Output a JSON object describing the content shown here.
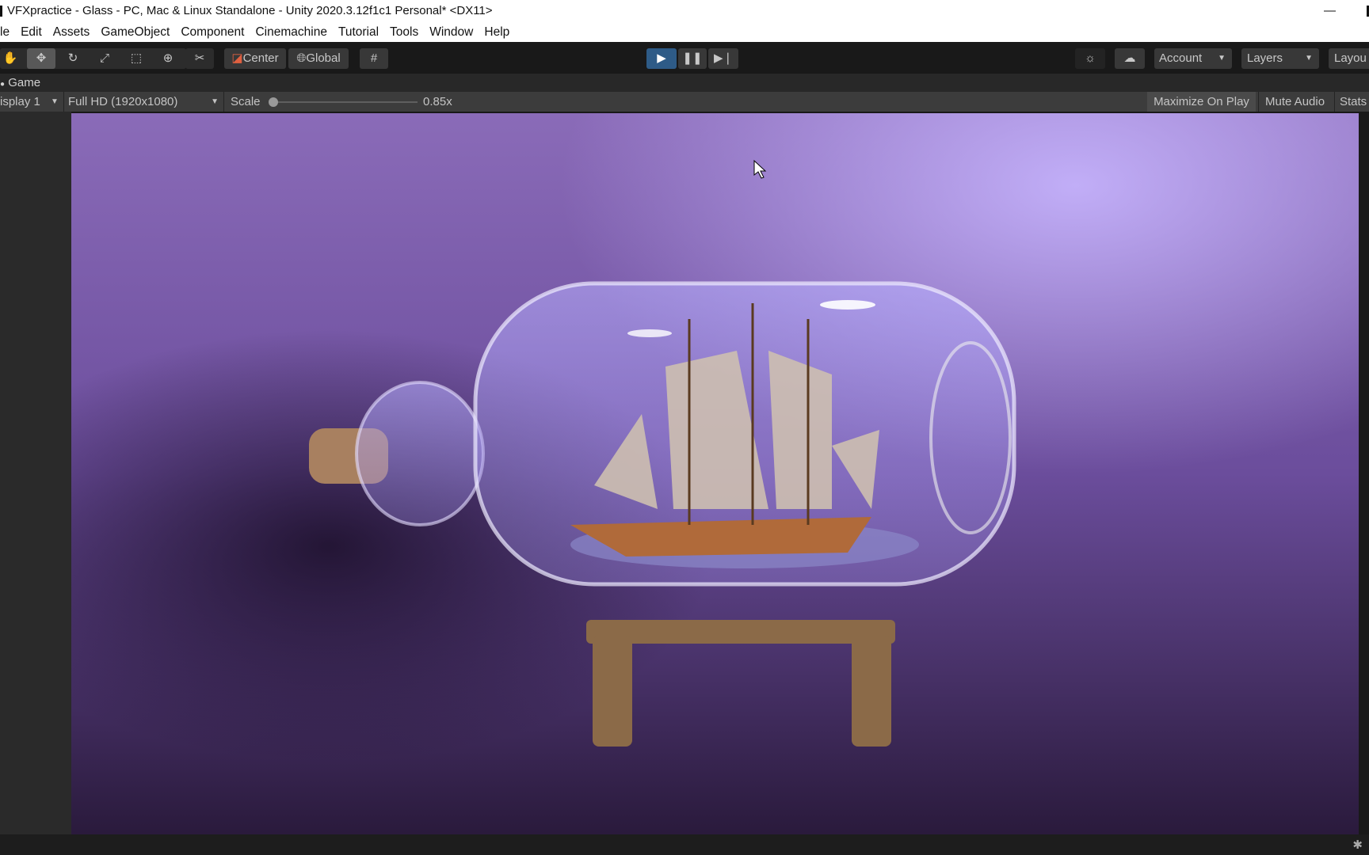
{
  "window": {
    "title": "VFXpractice - Glass - PC, Mac & Linux Standalone - Unity 2020.3.12f1c1 Personal* <DX11>",
    "minimize": "—"
  },
  "menu": [
    "le",
    "Edit",
    "Assets",
    "GameObject",
    "Component",
    "Cinemachine",
    "Tutorial",
    "Tools",
    "Window",
    "Help"
  ],
  "toolbar": {
    "pivot": "Center",
    "space": "Global",
    "account": "Account",
    "layers": "Layers",
    "layout": "Layou",
    "active_tool": "move",
    "playing": true
  },
  "game": {
    "tab": "Game",
    "display": "isplay 1",
    "resolution": "Full HD (1920x1080)",
    "scale_label": "Scale",
    "scale_value": "0.85x",
    "maximize": "Maximize On Play",
    "mute": "Mute Audio",
    "stats": "Stats"
  },
  "colors": {
    "play_active": "#2e5b87",
    "background": "#7a5aa8"
  }
}
